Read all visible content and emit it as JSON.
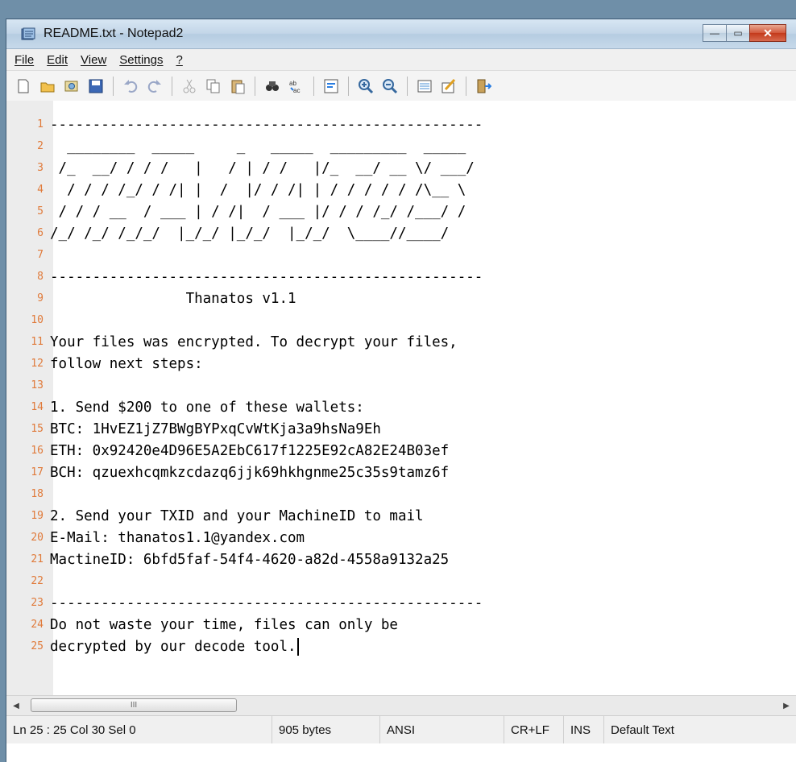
{
  "window": {
    "title": "README.txt - Notepad2",
    "controls": {
      "minimize": "—",
      "maximize": "▭",
      "close": "✕"
    }
  },
  "menu": [
    "File",
    "Edit",
    "View",
    "Settings",
    "?"
  ],
  "toolbar": [
    "new-icon",
    "open-icon",
    "browse-icon",
    "save-icon",
    "undo-icon",
    "redo-icon",
    "cut-icon",
    "copy-icon",
    "paste-icon",
    "find-icon",
    "replace-icon",
    "wordwrap-icon",
    "zoom-in-icon",
    "zoom-out-icon",
    "scheme-icon",
    "customize-icon",
    "exit-icon"
  ],
  "editor": {
    "lines": [
      {
        "n": "1",
        "text": "---------------------------------------------------"
      },
      {
        "n": "2",
        "text": "  ________  _____     _   _____  _________  _____"
      },
      {
        "n": "3",
        "text": " /_  __/ / / /   |   / | / /   |/_  __/ __ \\/ ___/"
      },
      {
        "n": "4",
        "text": "  / / / /_/ / /| |  /  |/ / /| | / / / / / /\\__ \\"
      },
      {
        "n": "5",
        "text": " / / / __  / ___ | / /|  / ___ |/ / / /_/ /___/ /"
      },
      {
        "n": "6",
        "text": "/_/ /_/ /_/_/  |_/_/ |_/_/  |_/_/  \\____//____/"
      },
      {
        "n": "7",
        "text": ""
      },
      {
        "n": "8",
        "text": "---------------------------------------------------"
      },
      {
        "n": "9",
        "text": "                Thanatos v1.1"
      },
      {
        "n": "10",
        "text": ""
      },
      {
        "n": "11",
        "text": "Your files was encrypted. To decrypt your files,"
      },
      {
        "n": "12",
        "text": "follow next steps:"
      },
      {
        "n": "13",
        "text": ""
      },
      {
        "n": "14",
        "text": "1. Send $200 to one of these wallets:"
      },
      {
        "n": "15",
        "text": "BTC: 1HvEZ1jZ7BWgBYPxqCvWtKja3a9hsNa9Eh"
      },
      {
        "n": "16",
        "text": "ETH: 0x92420e4D96E5A2EbC617f1225E92cA82E24B03ef"
      },
      {
        "n": "17",
        "text": "BCH: qzuexhcqmkzcdazq6jjk69hkhgnme25c35s9tamz6f"
      },
      {
        "n": "18",
        "text": ""
      },
      {
        "n": "19",
        "text": "2. Send your TXID and your MachineID to mail"
      },
      {
        "n": "20",
        "text": "E-Mail: thanatos1.1@yandex.com"
      },
      {
        "n": "21",
        "text": "MactineID: 6bfd5faf-54f4-4620-a82d-4558a9132a25"
      },
      {
        "n": "22",
        "text": ""
      },
      {
        "n": "23",
        "text": "---------------------------------------------------"
      },
      {
        "n": "24",
        "text": "Do not waste your time, files can only be"
      },
      {
        "n": "25",
        "text": "decrypted by our decode tool."
      }
    ],
    "caret_line": 25
  },
  "scrollbar": {
    "left_arrow": "◀",
    "right_arrow": "▶",
    "grip": "III"
  },
  "status": {
    "position": "Ln 25 : 25   Col 30   Sel 0",
    "size": "905 bytes",
    "encoding": "ANSI",
    "eol": "CR+LF",
    "mode": "INS",
    "scheme": "Default Text"
  },
  "colors": {
    "line_number": "#e07a3a",
    "gutter": "#ececec",
    "close_button": "#c3391b"
  }
}
